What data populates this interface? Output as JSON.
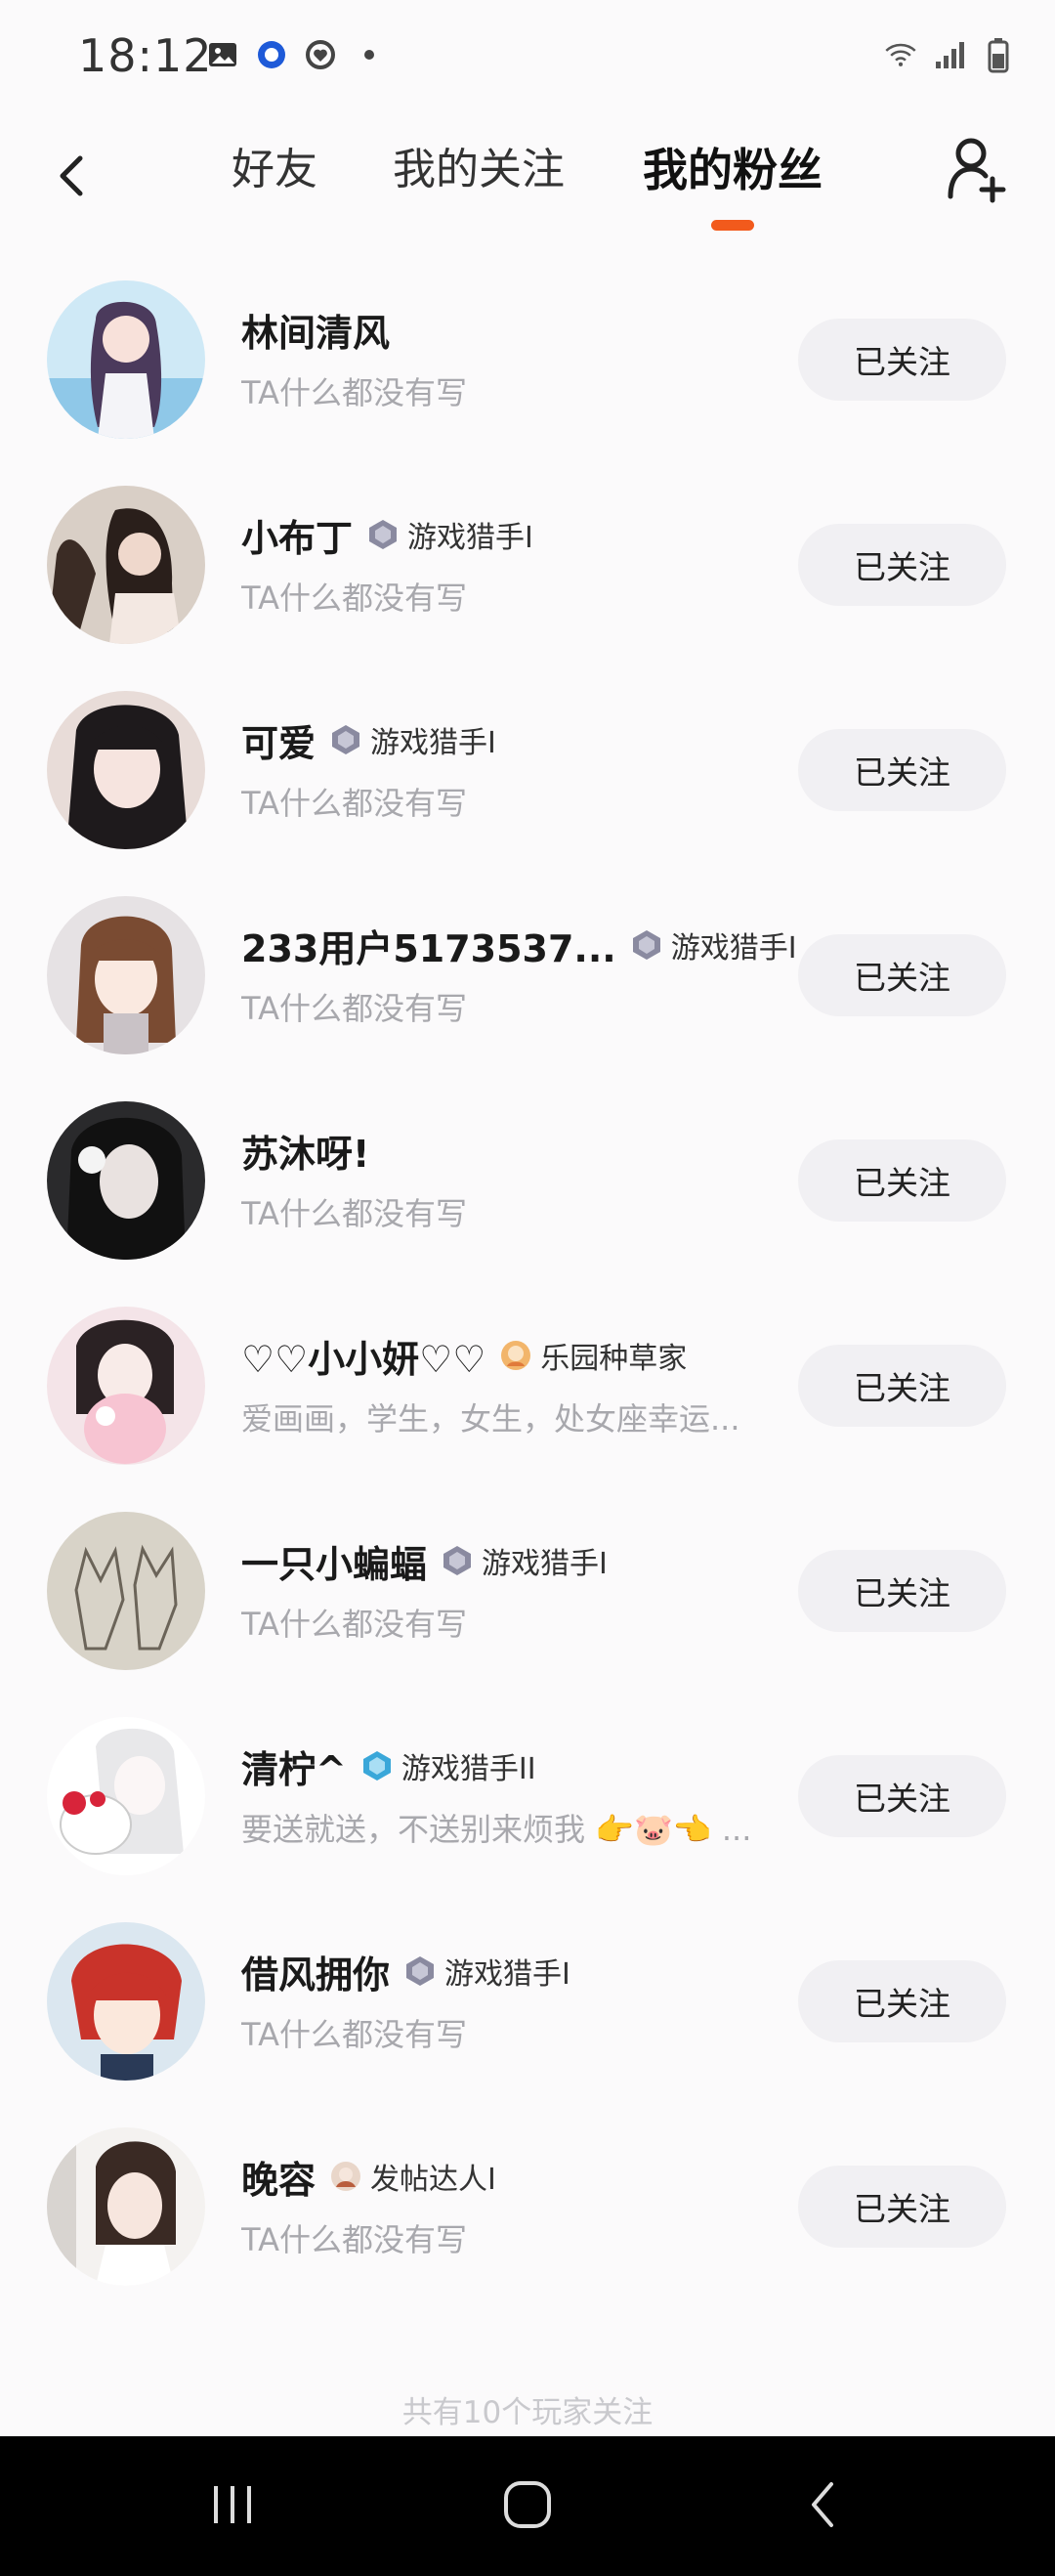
{
  "status_bar": {
    "time": "18:12",
    "left_icons": [
      "image-icon",
      "circle-icon",
      "heart-circle-icon",
      "dot-icon"
    ],
    "right_icons": [
      "wifi-icon",
      "signal-icon",
      "battery-icon"
    ]
  },
  "header": {
    "tabs": [
      {
        "label": "好友"
      },
      {
        "label": "我的关注"
      },
      {
        "label": "我的粉丝",
        "active": true
      }
    ],
    "accent_color": "#f25a1c"
  },
  "fans": [
    {
      "name": "林间清风",
      "badge": "",
      "bio": "TA什么都没有写",
      "button": "已关注"
    },
    {
      "name": "小布丁",
      "badge": "游戏猎手I",
      "bio": "TA什么都没有写",
      "button": "已关注"
    },
    {
      "name": "可爱",
      "badge": "游戏猎手I",
      "bio": "TA什么都没有写",
      "button": "已关注"
    },
    {
      "name": "233用户5173537...",
      "badge": "游戏猎手I",
      "bio": "TA什么都没有写",
      "button": "已关注"
    },
    {
      "name": "苏沐呀!",
      "badge": "",
      "bio": "TA什么都没有写",
      "button": "已关注"
    },
    {
      "name": "♡♡小小妍♡♡",
      "badge": "乐园种草家",
      "bio": "爱画画，学生，女生，处女座幸运...",
      "button": "已关注"
    },
    {
      "name": "一只小蝙蝠",
      "badge": "游戏猎手I",
      "bio": "TA什么都没有写",
      "button": "已关注"
    },
    {
      "name": "清柠^",
      "badge": "游戏猎手II",
      "bio": "要送就送，不送别来烦我 👉🐷👈 ...",
      "button": "已关注"
    },
    {
      "name": "借风拥你",
      "badge": "游戏猎手I",
      "bio": "TA什么都没有写",
      "button": "已关注"
    },
    {
      "name": "晚容",
      "badge": "发帖达人I",
      "bio": "TA什么都没有写",
      "button": "已关注"
    }
  ],
  "footer": "共有10个玩家关注"
}
